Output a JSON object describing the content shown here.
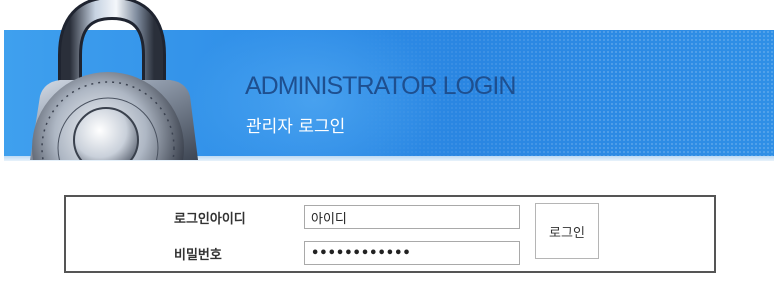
{
  "header": {
    "title_en": "ADMINISTRATOR LOGIN",
    "title_ko": "관리자 로그인"
  },
  "form": {
    "id_label": "로그인아이디",
    "id_value": "아이디",
    "password_label": "비밀번호",
    "password_value": "••••••••••••",
    "login_button": "로그인"
  },
  "colors": {
    "banner_blue": "#2f8ee8",
    "title_navy": "#1e4f8f",
    "border_gray": "#555555"
  },
  "icons": [
    "padlock-icon"
  ]
}
